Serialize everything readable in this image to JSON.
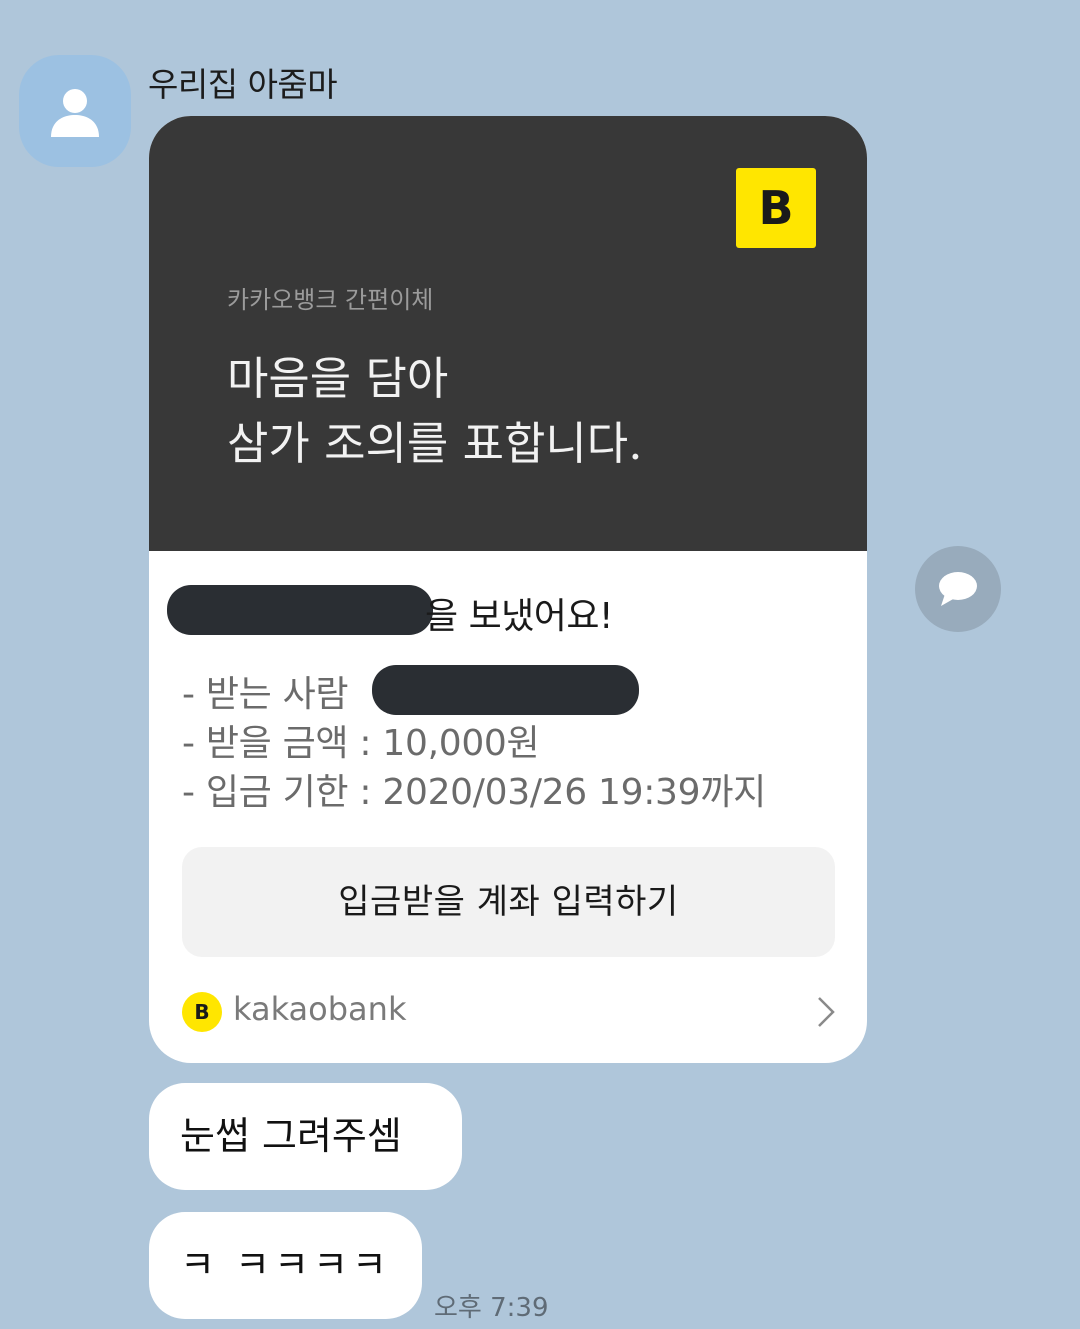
{
  "chat": {
    "sender_name": "우리집 아줌마",
    "avatar_icon": "person-silhouette-icon"
  },
  "card": {
    "logo_letter": "B",
    "service_name": "카카오뱅크 간편이체",
    "headline_line1": "마음을 담아",
    "headline_line2": "삼가 조의를 표합니다.",
    "sent_message_suffix": "을 보냈어요!",
    "recipient_label": "- 받는 사람",
    "amount_line": "- 받을 금액 : 10,000원",
    "deadline_line": "- 입금 기한 : 2020/03/26 19:39까지",
    "action_button": "입금받을 계좌 입력하기",
    "footer_logo_letter": "B",
    "footer_brand": "kakaobank",
    "colors": {
      "top_bg": "#383838",
      "brand_yellow": "#ffe600"
    }
  },
  "messages": [
    {
      "text": "눈썹 그려주셈"
    },
    {
      "text": "ㅋ ㅋㅋㅋㅋ"
    }
  ],
  "timestamp": "오후 7:39",
  "colors": {
    "chat_bg": "#afc6da",
    "bubble_bg": "#ffffff"
  }
}
